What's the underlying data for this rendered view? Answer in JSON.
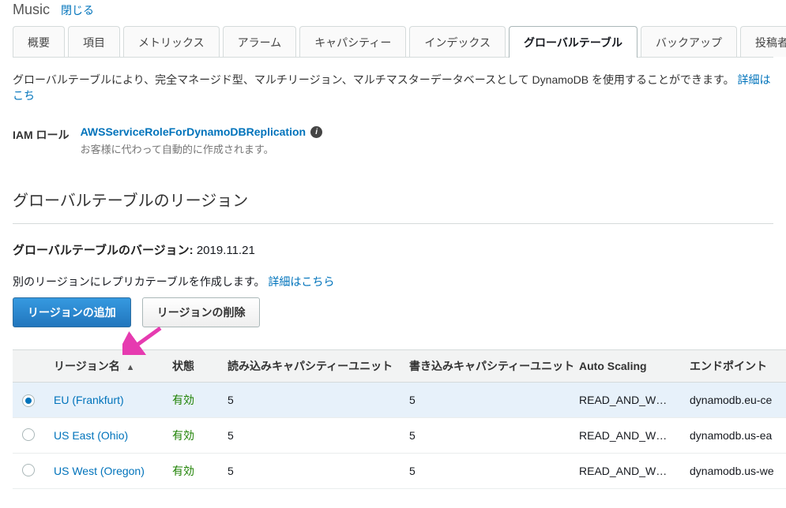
{
  "header": {
    "table_name": "Music",
    "close_label": "閉じる"
  },
  "tabs": [
    {
      "label": "概要"
    },
    {
      "label": "項目"
    },
    {
      "label": "メトリックス"
    },
    {
      "label": "アラーム"
    },
    {
      "label": "キャパシティー"
    },
    {
      "label": "インデックス"
    },
    {
      "label": "グローバルテーブル"
    },
    {
      "label": "バックアップ"
    },
    {
      "label": "投稿者のインサイト"
    }
  ],
  "active_tab_index": 6,
  "description": {
    "text": "グローバルテーブルにより、完全マネージド型、マルチリージョン、マルチマスターデータベースとして DynamoDB を使用することができます。",
    "more": "詳細はこち"
  },
  "iam": {
    "label": "IAM ロール",
    "role_name": "AWSServiceRoleForDynamoDBReplication",
    "subtext": "お客様に代わって自動的に作成されます。"
  },
  "regions_section_title": "グローバルテーブルのリージョン",
  "version": {
    "label": "グローバルテーブルのバージョン:",
    "value": "2019.11.21"
  },
  "replica": {
    "text": "別のリージョンにレプリカテーブルを作成します。",
    "more": "詳細はこちら"
  },
  "buttons": {
    "add_region": "リージョンの追加",
    "delete_region": "リージョンの削除"
  },
  "table": {
    "headers": {
      "region": "リージョン名",
      "status": "状態",
      "read_capacity": "読み込みキャパシティーユニット",
      "write_capacity": "書き込みキャパシティーユニット",
      "auto_scaling": "Auto Scaling",
      "endpoint": "エンドポイント"
    },
    "rows": [
      {
        "selected": true,
        "region": "EU (Frankfurt)",
        "status": "有効",
        "read": "5",
        "write": "5",
        "auto_scaling": "READ_AND_WRITE",
        "endpoint": "dynamodb.eu-ce"
      },
      {
        "selected": false,
        "region": "US East (Ohio)",
        "status": "有効",
        "read": "5",
        "write": "5",
        "auto_scaling": "READ_AND_WRITE",
        "endpoint": "dynamodb.us-ea"
      },
      {
        "selected": false,
        "region": "US West (Oregon)",
        "status": "有効",
        "read": "5",
        "write": "5",
        "auto_scaling": "READ_AND_WRITE",
        "endpoint": "dynamodb.us-we"
      }
    ]
  }
}
